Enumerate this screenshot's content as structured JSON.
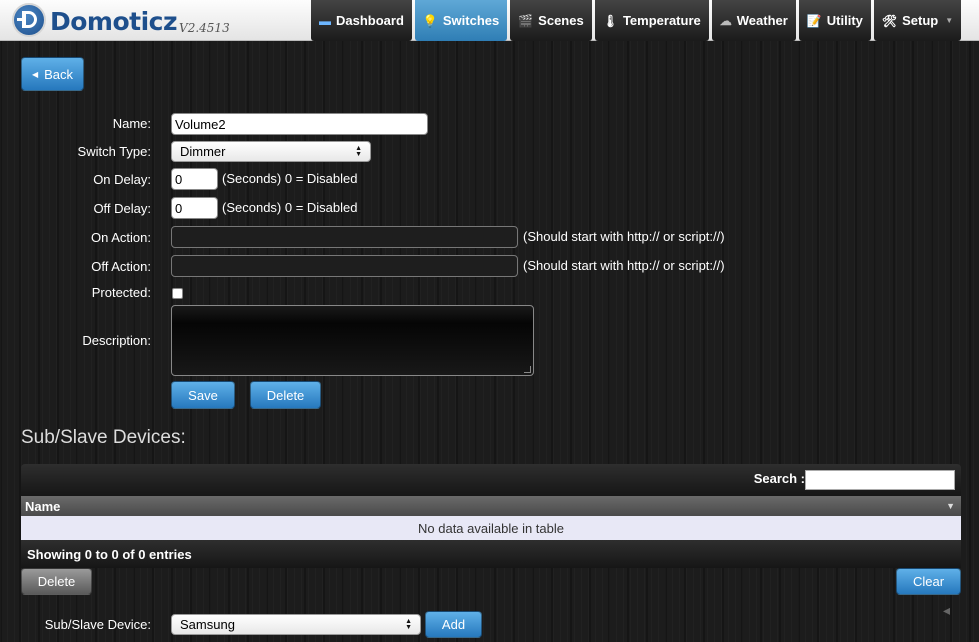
{
  "app": {
    "name": "Domoticz",
    "version": "V2.4513"
  },
  "nav": [
    {
      "label": "Dashboard",
      "icon": "dashboard-icon",
      "glyph": "▬"
    },
    {
      "label": "Switches",
      "icon": "lightbulb-icon",
      "glyph": "💡",
      "active": true
    },
    {
      "label": "Scenes",
      "icon": "clapperboard-icon",
      "glyph": "🎬"
    },
    {
      "label": "Temperature",
      "icon": "thermometer-icon",
      "glyph": "🌡"
    },
    {
      "label": "Weather",
      "icon": "cloud-rain-icon",
      "glyph": "☁"
    },
    {
      "label": "Utility",
      "icon": "notepad-icon",
      "glyph": "📝"
    },
    {
      "label": "Setup",
      "icon": "tools-icon",
      "glyph": "🛠",
      "dropdown": true
    }
  ],
  "back_label": "Back",
  "form": {
    "name_label": "Name:",
    "name_value": "Volume2",
    "switch_type_label": "Switch Type:",
    "switch_type_value": "Dimmer",
    "on_delay_label": "On Delay:",
    "on_delay_value": "0",
    "off_delay_label": "Off Delay:",
    "off_delay_value": "0",
    "delay_hint": "(Seconds) 0 = Disabled",
    "on_action_label": "On Action:",
    "on_action_value": "",
    "off_action_label": "Off Action:",
    "off_action_value": "",
    "action_hint": "(Should start with http:// or script://)",
    "protected_label": "Protected:",
    "protected_checked": false,
    "description_label": "Description:",
    "description_value": "",
    "save_label": "Save",
    "delete_label": "Delete"
  },
  "subslave": {
    "title": "Sub/Slave Devices:",
    "search_label": "Search :",
    "search_value": "",
    "column_name": "Name",
    "empty_message": "No data available in table",
    "info": "Showing 0 to 0 of 0 entries",
    "delete_label": "Delete",
    "clear_label": "Clear",
    "device_label": "Sub/Slave Device:",
    "device_value": "Samsung",
    "add_label": "Add"
  },
  "colors": {
    "accent": "#2f7eb5",
    "brand": "#1e4f8c",
    "background": "#1c1c1c"
  }
}
